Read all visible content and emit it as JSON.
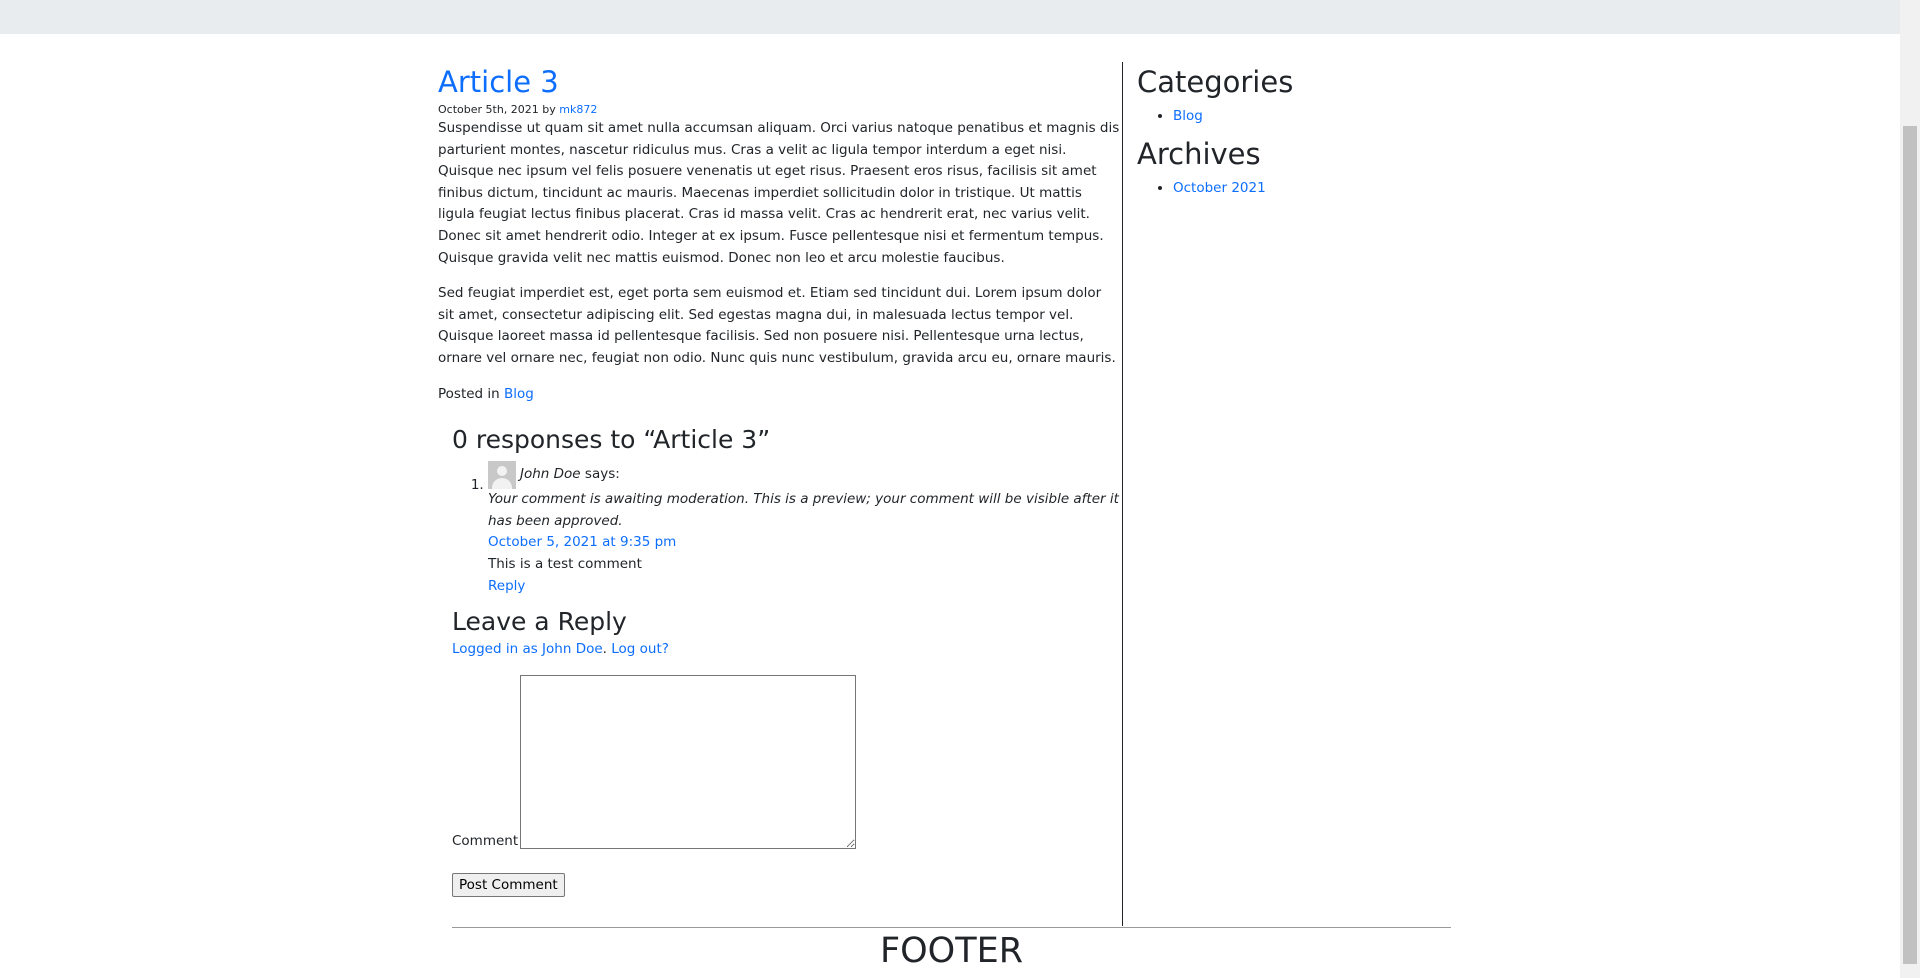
{
  "post": {
    "title": "Article 3",
    "date": "October 5th, 2021",
    "by_text": "by",
    "author": "mk872",
    "paragraphs": [
      "Suspendisse ut quam sit amet nulla accumsan aliquam. Orci varius natoque penatibus et magnis dis parturient montes, nascetur ridiculus mus. Cras a velit ac ligula tempor interdum a eget nisi. Quisque nec ipsum vel felis posuere venenatis ut eget risus. Praesent eros risus, facilisis sit amet finibus dictum, tincidunt ac mauris. Maecenas imperdiet sollicitudin dolor in tristique. Ut mattis ligula feugiat lectus finibus placerat. Cras id massa velit. Cras ac hendrerit erat, nec varius velit. Donec sit amet hendrerit odio. Integer at ex ipsum. Fusce pellentesque nisi et fermentum tempus. Quisque gravida velit nec mattis euismod. Donec non leo et arcu molestie faucibus.",
      "Sed feugiat imperdiet est, eget porta sem euismod et. Etiam sed tincidunt dui. Lorem ipsum dolor sit amet, consectetur adipiscing elit. Sed egestas magna dui, in malesuada lectus tempor vel. Quisque laoreet massa id pellentesque facilisis. Sed non posuere nisi. Pellentesque urna lectus, ornare vel ornare nec, feugiat non odio. Nunc quis nunc vestibulum, gravida arcu eu, ornare mauris."
    ],
    "posted_in_label": "Posted in",
    "category": "Blog"
  },
  "comments": {
    "heading": "0 responses to “Article 3”",
    "items": [
      {
        "author": "John Doe",
        "says": "says:",
        "moderation": "Your comment is awaiting moderation. This is a preview; your comment will be visible after it has been approved.",
        "date": "October 5, 2021 at 9:35 pm",
        "text": "This is a test comment",
        "reply": "Reply"
      }
    ]
  },
  "reply_form": {
    "heading": "Leave a Reply",
    "logged_in": "Logged in as John Doe",
    "logout": "Log out?",
    "comment_label": "Comment",
    "submit": "Post Comment"
  },
  "sidebar": {
    "categories_heading": "Categories",
    "categories": [
      "Blog"
    ],
    "archives_heading": "Archives",
    "archives": [
      "October 2021"
    ]
  },
  "footer": {
    "text": "FOOTER"
  }
}
